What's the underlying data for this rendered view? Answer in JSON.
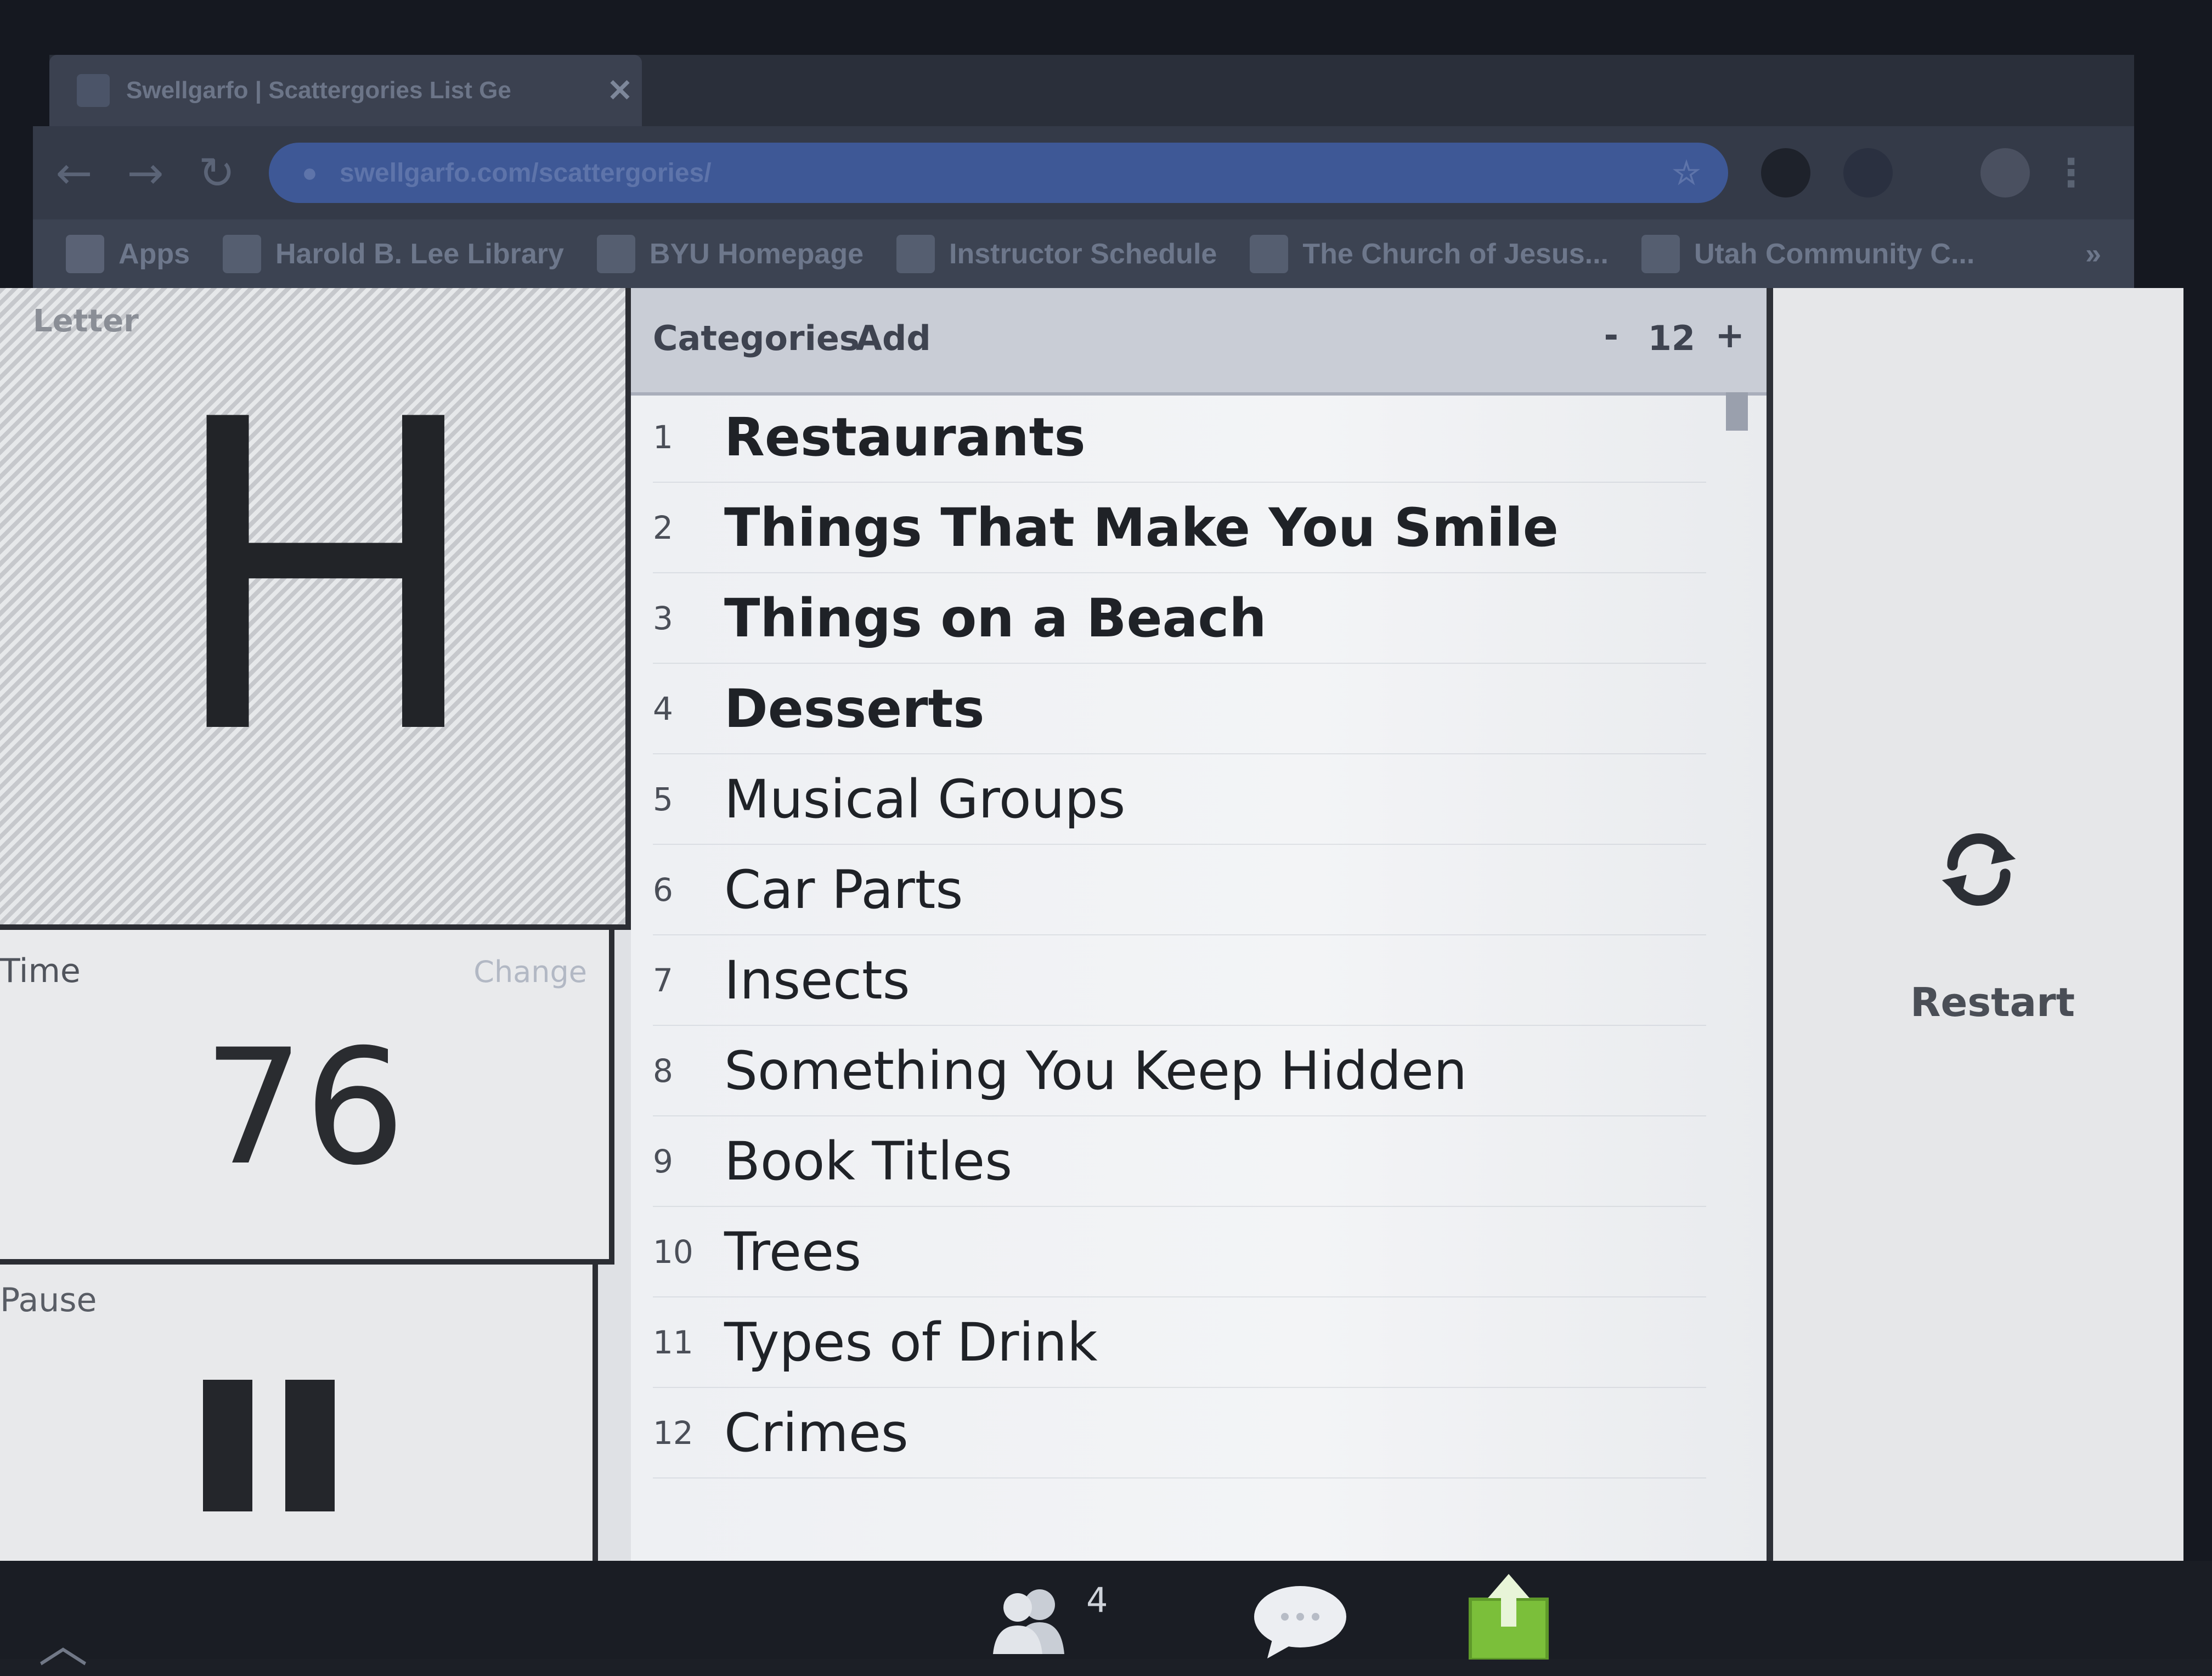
{
  "browser": {
    "tab": {
      "title": "Swellgarfo | Scattergories List Ge",
      "close": "✕"
    },
    "nav": {
      "back": "←",
      "forward": "→",
      "reload": "↻"
    },
    "address": {
      "url": "swellgarfo.com/scattergories/"
    },
    "bookmarks": [
      {
        "label": "Apps",
        "icon": "apps-grid-icon"
      },
      {
        "label": "Harold B. Lee Library",
        "icon": "library-icon"
      },
      {
        "label": "BYU Homepage",
        "icon": "byu-icon"
      },
      {
        "label": "Instructor Schedule",
        "icon": "y-icon"
      },
      {
        "label": "The Church of Jesus...",
        "icon": "church-icon"
      },
      {
        "label": "Utah Community C...",
        "icon": "credit-union-icon"
      }
    ],
    "bookmarks_overflow": "»"
  },
  "letter": {
    "label": "Letter",
    "value": "H"
  },
  "time": {
    "label": "Time",
    "change_link": "Change",
    "value": "76"
  },
  "pause": {
    "label": "Pause"
  },
  "categories": {
    "title": "Categories",
    "add": "Add",
    "minus": "-",
    "count": "12",
    "plus": "+",
    "items": [
      {
        "num": "1",
        "name": "Restaurants"
      },
      {
        "num": "2",
        "name": "Things That Make You Smile"
      },
      {
        "num": "3",
        "name": "Things on a Beach"
      },
      {
        "num": "4",
        "name": "Desserts"
      },
      {
        "num": "5",
        "name": "Musical Groups"
      },
      {
        "num": "6",
        "name": "Car Parts"
      },
      {
        "num": "7",
        "name": "Insects"
      },
      {
        "num": "8",
        "name": "Something You Keep Hidden"
      },
      {
        "num": "9",
        "name": "Book Titles"
      },
      {
        "num": "10",
        "name": "Trees"
      },
      {
        "num": "11",
        "name": "Types of Drink"
      },
      {
        "num": "12",
        "name": "Crimes"
      }
    ]
  },
  "restart": {
    "label": "Restart"
  },
  "meeting_bar": {
    "participants_count": "4"
  },
  "colors": {
    "share_green": "#7bbf3a",
    "omnibox_blue": "#3e5896",
    "text_dark": "#1f2227"
  }
}
